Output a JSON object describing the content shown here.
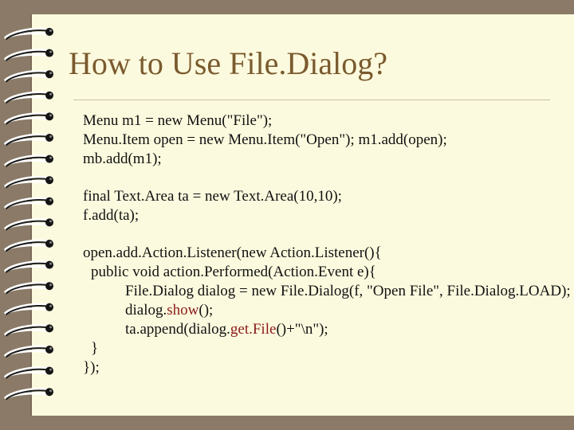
{
  "slide": {
    "title": "How to Use File.Dialog?",
    "code": {
      "l1": "Menu m1 = new Menu(\"File\");",
      "l2": "Menu.Item open = new Menu.Item(\"Open\"); m1.add(open);",
      "l3": "mb.add(m1);",
      "l4": "final Text.Area ta = new Text.Area(10,10);",
      "l5": "f.add(ta);",
      "l6": "open.add.Action.Listener(new Action.Listener(){",
      "l7": "public void action.Performed(Action.Event e){",
      "l8": "File.Dialog dialog = new File.Dialog(f, \"Open File\", File.Dialog.LOAD);",
      "l9a": "dialog.",
      "l9b": "show",
      "l9c": "();",
      "l10a": "ta.append(dialog.",
      "l10b": "get.File",
      "l10c": "()+\"\\n\");",
      "l11": "}",
      "l12": "});"
    }
  },
  "colors": {
    "background": "#8a7a67",
    "page": "#fcfade",
    "title": "#7a5a2e",
    "highlight": "#8b1a1a"
  },
  "icons": {
    "binding": "spiral-ring-icon"
  }
}
